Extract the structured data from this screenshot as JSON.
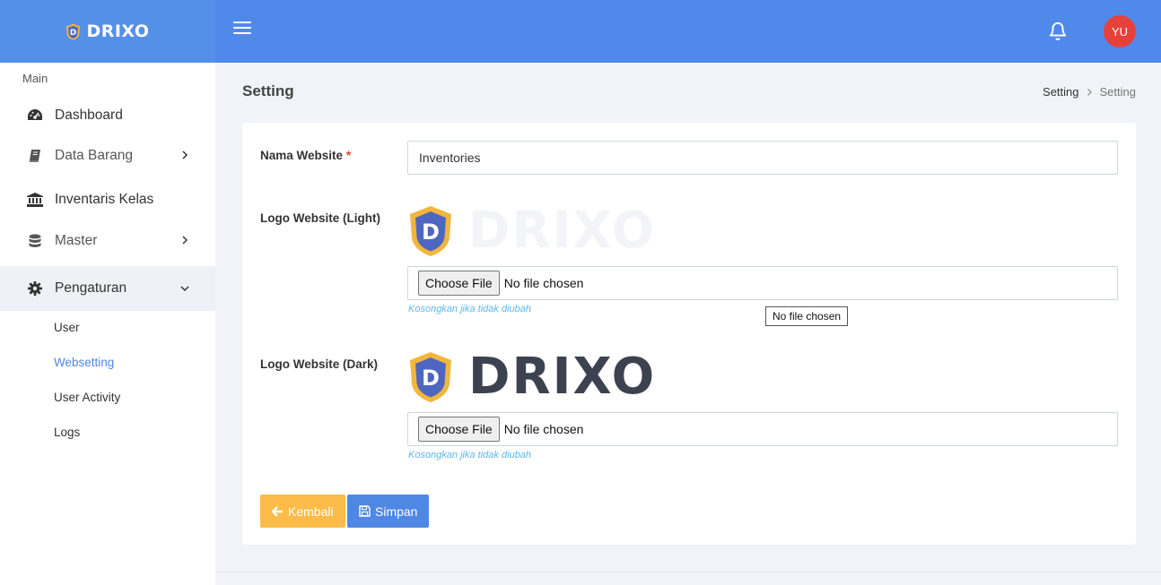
{
  "brand": {
    "name": "DRIXO"
  },
  "header": {
    "avatar_initials": "YU",
    "icons": [
      "menu-icon",
      "bell-icon"
    ]
  },
  "sidebar": {
    "section_label": "Main",
    "items": [
      {
        "label": "Dashboard",
        "icon": "dashboard-icon"
      },
      {
        "label": "Data Barang",
        "icon": "book-icon"
      },
      {
        "label": "Inventaris Kelas",
        "icon": "institution-icon"
      },
      {
        "label": "Master",
        "icon": "database-icon"
      },
      {
        "label": "Pengaturan",
        "icon": "gear-icon"
      }
    ],
    "subitems": [
      {
        "label": "User"
      },
      {
        "label": "Websetting"
      },
      {
        "label": "User Activity"
      },
      {
        "label": "Logs"
      }
    ]
  },
  "page": {
    "title": "Setting",
    "breadcrumb": [
      "Setting",
      "Setting"
    ]
  },
  "form": {
    "nama_label": "Nama Website",
    "required_mark": "*",
    "nama_value": "Inventories",
    "logo_light_label": "Logo Website (Light)",
    "logo_dark_label": "Logo Website (Dark)",
    "logo_text": "DRIXO",
    "logo_letter": "D",
    "choose_file_label": "Choose File",
    "no_file_text": "No file chosen",
    "hint": "Kosongkan jika tidak diubah",
    "tooltip": "No file chosen",
    "back_label": "Kembali",
    "save_label": "Simpan"
  },
  "colors": {
    "topbar": "#5189ea",
    "accent": "#4f87e0",
    "warning": "#fdbb49",
    "danger": "#e5413a",
    "hint": "#5db7ea"
  }
}
